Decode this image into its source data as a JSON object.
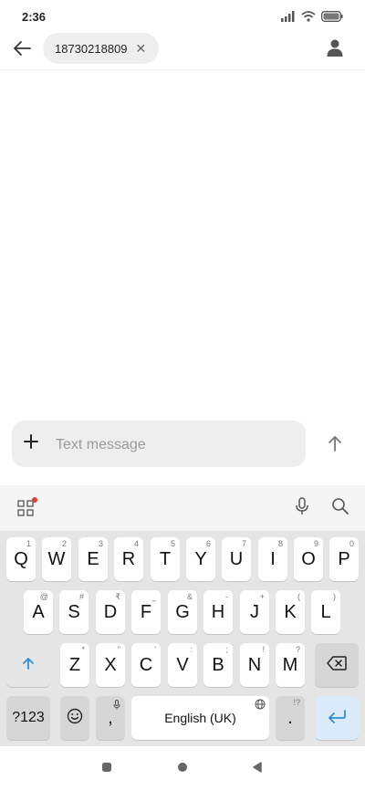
{
  "status_bar": {
    "time": "2:36",
    "icons": [
      "signal-icon",
      "wifi-icon",
      "battery-icon"
    ]
  },
  "header": {
    "back_icon": "back-arrow-icon",
    "recipient": "18730218809",
    "remove_icon": "close-icon",
    "remove_glyph": "✕",
    "contact_icon": "contact-person-icon"
  },
  "compose": {
    "add_icon": "plus-icon",
    "placeholder": "Text message",
    "value": "",
    "send_icon": "send-arrow-icon"
  },
  "keyboard": {
    "toolbar": {
      "left_icon": "apps-grid-icon",
      "notification_dot_color": "#e53935",
      "right_icons": [
        "mic-icon",
        "search-icon"
      ]
    },
    "row1": [
      {
        "label": "Q",
        "hint": "1"
      },
      {
        "label": "W",
        "hint": "2"
      },
      {
        "label": "E",
        "hint": "3"
      },
      {
        "label": "R",
        "hint": "4"
      },
      {
        "label": "T",
        "hint": "5"
      },
      {
        "label": "Y",
        "hint": "6"
      },
      {
        "label": "U",
        "hint": "7"
      },
      {
        "label": "I",
        "hint": "8"
      },
      {
        "label": "O",
        "hint": "9"
      },
      {
        "label": "P",
        "hint": "0"
      }
    ],
    "row2": [
      {
        "label": "A",
        "hint": "@"
      },
      {
        "label": "S",
        "hint": "#"
      },
      {
        "label": "D",
        "hint": "₹"
      },
      {
        "label": "F",
        "hint": "_"
      },
      {
        "label": "G",
        "hint": "&"
      },
      {
        "label": "H",
        "hint": "-"
      },
      {
        "label": "J",
        "hint": "+"
      },
      {
        "label": "K",
        "hint": "("
      },
      {
        "label": "L",
        "hint": ")"
      }
    ],
    "row3": [
      {
        "label": "Z",
        "hint": "*"
      },
      {
        "label": "X",
        "hint": "\""
      },
      {
        "label": "C",
        "hint": "'"
      },
      {
        "label": "V",
        "hint": ":"
      },
      {
        "label": "B",
        "hint": ";"
      },
      {
        "label": "N",
        "hint": "!"
      },
      {
        "label": "M",
        "hint": "?"
      }
    ],
    "shift_icon": "shift-arrow-icon",
    "backspace_icon": "backspace-icon",
    "symbols_label": "?123",
    "emoji_icon": "emoji-icon",
    "comma_label": ",",
    "comma_hint_icon": "mic-icon",
    "space_label": "English (UK)",
    "space_hint_icon": "globe-icon",
    "period_label": ".",
    "period_hint": "!?",
    "enter_icon": "enter-arrow-icon",
    "accent_color": "#2f8fd6"
  },
  "nav_bar": {
    "icons": [
      "recents-square-icon",
      "home-circle-icon",
      "back-triangle-icon"
    ]
  }
}
